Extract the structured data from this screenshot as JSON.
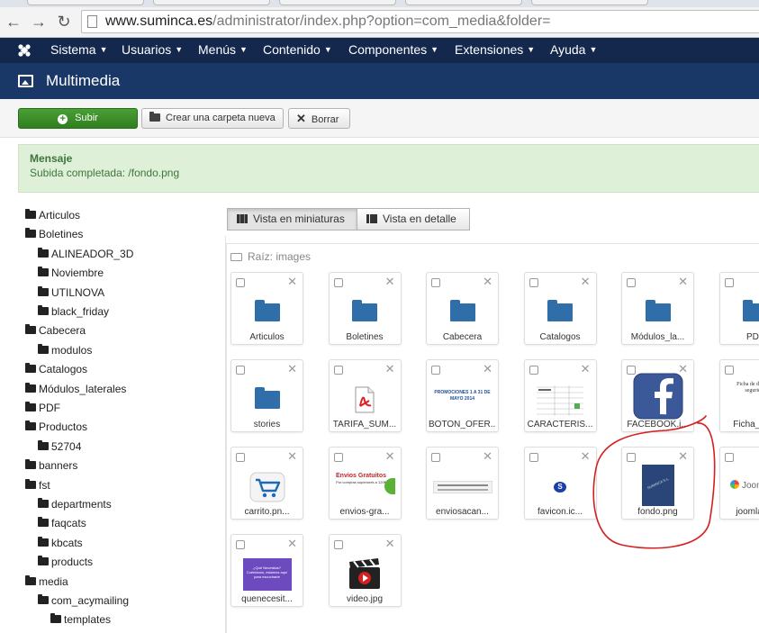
{
  "browser": {
    "url_host": "www.suminca.es",
    "url_path": "/administrator/index.php?option=com_media&folder="
  },
  "menu": [
    {
      "label": "Sistema"
    },
    {
      "label": "Usuarios"
    },
    {
      "label": "Menús"
    },
    {
      "label": "Contenido"
    },
    {
      "label": "Componentes"
    },
    {
      "label": "Extensiones"
    },
    {
      "label": "Ayuda"
    }
  ],
  "page": {
    "title": "Multimedia"
  },
  "toolbar": {
    "upload": "Subir",
    "new_folder": "Crear una carpeta nueva",
    "delete": "Borrar"
  },
  "message": {
    "title": "Mensaje",
    "text": "Subida completada: /fondo.png"
  },
  "tree": [
    {
      "label": "Articulos",
      "level": 0
    },
    {
      "label": "Boletines",
      "level": 0
    },
    {
      "label": "ALINEADOR_3D",
      "level": 1
    },
    {
      "label": "Noviembre",
      "level": 1
    },
    {
      "label": "UTILNOVA",
      "level": 1
    },
    {
      "label": "black_friday",
      "level": 1
    },
    {
      "label": "Cabecera",
      "level": 0
    },
    {
      "label": "modulos",
      "level": 1
    },
    {
      "label": "Catalogos",
      "level": 0
    },
    {
      "label": "Módulos_laterales",
      "level": 0
    },
    {
      "label": "PDF",
      "level": 0
    },
    {
      "label": "Productos",
      "level": 0
    },
    {
      "label": "52704",
      "level": 1
    },
    {
      "label": "banners",
      "level": 0
    },
    {
      "label": "fst",
      "level": 0
    },
    {
      "label": "departments",
      "level": 1
    },
    {
      "label": "faqcats",
      "level": 1
    },
    {
      "label": "kbcats",
      "level": 1
    },
    {
      "label": "products",
      "level": 1
    },
    {
      "label": "media",
      "level": 0
    },
    {
      "label": "com_acymailing",
      "level": 1
    },
    {
      "label": "templates",
      "level": 2
    }
  ],
  "views": {
    "thumbs": "Vista en miniaturas",
    "details": "Vista en detalle"
  },
  "breadcrumb": "Raíz: images",
  "items": [
    {
      "label": "Articulos",
      "kind": "folder"
    },
    {
      "label": "Boletines",
      "kind": "folder"
    },
    {
      "label": "Cabecera",
      "kind": "folder"
    },
    {
      "label": "Catalogos",
      "kind": "folder"
    },
    {
      "label": "Módulos_la...",
      "kind": "folder"
    },
    {
      "label": "PDF",
      "kind": "folder"
    },
    {
      "label": "stories",
      "kind": "folder"
    },
    {
      "label": "TARIFA_SUM...",
      "kind": "pdf"
    },
    {
      "label": "BOTON_OFER...",
      "kind": "promo",
      "caption": "PROMOCIONES 1 A 31 DE MAYO 2014"
    },
    {
      "label": "CARACTERIS...",
      "kind": "sheet"
    },
    {
      "label": "FACEBOOK.j...",
      "kind": "facebook"
    },
    {
      "label": "Ficha_de...",
      "kind": "doc",
      "caption": "Ficha de datos de seguridad"
    },
    {
      "label": "carrito.pn...",
      "kind": "cart"
    },
    {
      "label": "envios-gra...",
      "kind": "envios",
      "caption": "Envios Gratuitos",
      "subcaption": "Por compras superiores a 120€"
    },
    {
      "label": "enviosacan...",
      "kind": "strip"
    },
    {
      "label": "favicon.ic...",
      "kind": "favicon"
    },
    {
      "label": "fondo.png",
      "kind": "fondo",
      "caption": "SUMINCA S.L."
    },
    {
      "label": "joomla_...",
      "kind": "joomla",
      "caption": "Joomla!"
    },
    {
      "label": "quenecesit...",
      "kind": "purple",
      "caption": "¿Qué Necesitas? Cuéntanos, estamos aquí para escucharte"
    },
    {
      "label": "video.jpg",
      "kind": "video"
    }
  ],
  "colors": {
    "menu_bg": "#14284d",
    "title_bg": "#1a3867",
    "success_bg": "#dff0d8",
    "upload_green": "#3a8f29",
    "folder_blue": "#2f6ea8",
    "annotation_red": "#d42020"
  }
}
